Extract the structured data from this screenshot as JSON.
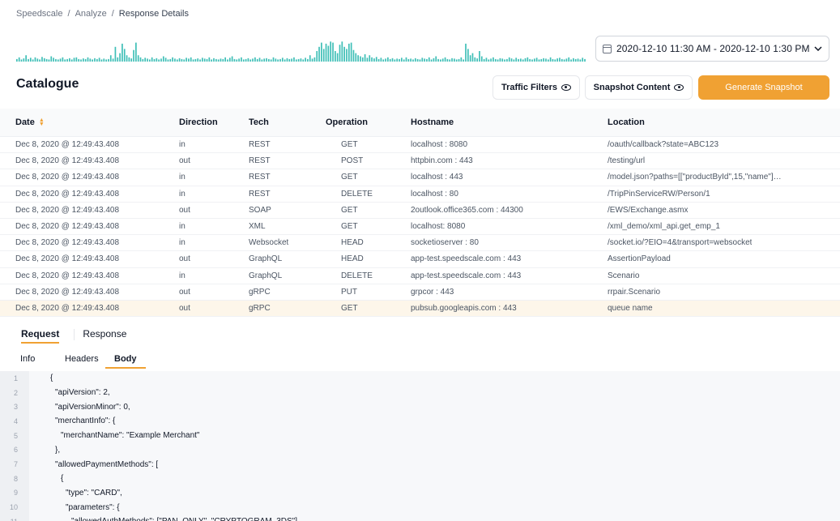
{
  "breadcrumb": [
    "Speedscale",
    "Analyze",
    "Response Details"
  ],
  "date_range": "2020-12-10 11:30 AM - 2020-12-10 1:30 PM",
  "catalogue": {
    "title": "Catalogue",
    "traffic_filters": "Traffic Filters",
    "snapshot_content": "Snapshot Content",
    "generate_snapshot": "Generate Snapshot"
  },
  "table": {
    "headers": [
      "Date",
      "Direction",
      "Tech",
      "Operation",
      "Hostname",
      "Location"
    ],
    "rows": [
      [
        "Dec 8, 2020 @ 12:49:43.408",
        "in",
        "REST",
        "GET",
        "localhost : 8080",
        "/oauth/callback?state=ABC123"
      ],
      [
        "Dec 8, 2020 @ 12:49:43.408",
        "out",
        "REST",
        "POST",
        "httpbin.com : 443",
        "/testing/url"
      ],
      [
        "Dec 8, 2020 @ 12:49:43.408",
        "in",
        "REST",
        "GET",
        "localhost : 443",
        "/model.json?paths=[[\"productById\",15,\"name\"]…"
      ],
      [
        "Dec 8, 2020 @ 12:49:43.408",
        "in",
        "REST",
        "DELETE",
        "localhost : 80",
        "/TripPinServiceRW/Person/1"
      ],
      [
        "Dec 8, 2020 @ 12:49:43.408",
        "out",
        "SOAP",
        "GET",
        "2outlook.office365.com : 44300",
        "/EWS/Exchange.asmx"
      ],
      [
        "Dec 8, 2020 @ 12:49:43.408",
        "in",
        "XML",
        "GET",
        "localhost: 8080",
        "/xml_demo/xml_api.get_emp_1"
      ],
      [
        "Dec 8, 2020 @ 12:49:43.408",
        "in",
        "Websocket",
        "HEAD",
        "socketioserver : 80",
        "/socket.io/?EIO=4&transport=websocket"
      ],
      [
        "Dec 8, 2020 @ 12:49:43.408",
        "out",
        "GraphQL",
        "HEAD",
        "app-test.speedscale.com : 443",
        "AssertionPayload"
      ],
      [
        "Dec 8, 2020 @ 12:49:43.408",
        "in",
        "GraphQL",
        "DELETE",
        "app-test.speedscale.com : 443",
        "Scenario"
      ],
      [
        "Dec 8, 2020 @ 12:49:43.408",
        "out",
        "gRPC",
        "PUT",
        "grpcor : 443",
        "rrpair.Scenario"
      ],
      [
        "Dec 8, 2020 @ 12:49:43.408",
        "out",
        "gRPC",
        "GET",
        "pubsub.googleapis.com : 443",
        "queue name"
      ]
    ],
    "selected_row": 10
  },
  "detail_tabs": [
    "Request",
    "Response"
  ],
  "sub_tabs": [
    "Info",
    "Headers",
    "Body"
  ],
  "code_lines": [
    {
      "n": "1",
      "indent": 62,
      "text": "{"
    },
    {
      "n": "2",
      "indent": 68,
      "text": "\"apiVersion\": 2,"
    },
    {
      "n": "3",
      "indent": 68,
      "text": "\"apiVersionMinor\": 0,"
    },
    {
      "n": "4",
      "indent": 68,
      "text": "\"merchantInfo\": {"
    },
    {
      "n": "5",
      "indent": 75,
      "text": "\"merchantName\": \"Example Merchant\""
    },
    {
      "n": "6",
      "indent": 68,
      "text": "},"
    },
    {
      "n": "7",
      "indent": 68,
      "text": "\"allowedPaymentMethods\": ["
    },
    {
      "n": "8",
      "indent": 75,
      "text": "{"
    },
    {
      "n": "9",
      "indent": 81,
      "text": "\"type\": \"CARD\","
    },
    {
      "n": "10",
      "indent": 81,
      "text": "\"parameters\": {"
    },
    {
      "n": "11",
      "indent": 88,
      "text": "\"allowedAuthMethods\": [\"PAN_ONLY\", \"CRYPTOGRAM_3DS\"],"
    }
  ],
  "colors": {
    "accent": "#f0a133",
    "spark": "#3fbfb7",
    "selected_row": "#fdf6ea"
  },
  "spark_levels": [
    0.12,
    0.2,
    0.1,
    0.15,
    0.3,
    0.12,
    0.18,
    0.1,
    0.2,
    0.14,
    0.1,
    0.22,
    0.16,
    0.12,
    0.1,
    0.25,
    0.18,
    0.12,
    0.1,
    0.14,
    0.2,
    0.1,
    0.12,
    0.16,
    0.1,
    0.18,
    0.2,
    0.12,
    0.1,
    0.15,
    0.12,
    0.2,
    0.14,
    0.1,
    0.16,
    0.12,
    0.18,
    0.1,
    0.14,
    0.1,
    0.12,
    0.3,
    0.14,
    0.7,
    0.2,
    0.4,
    0.85,
    0.6,
    0.3,
    0.2,
    0.15,
    0.55,
    0.9,
    0.3,
    0.2,
    0.12,
    0.18,
    0.14,
    0.1,
    0.2,
    0.12,
    0.16,
    0.1,
    0.14,
    0.25,
    0.18,
    0.1,
    0.12,
    0.2,
    0.14,
    0.1,
    0.16,
    0.12,
    0.1,
    0.18,
    0.14,
    0.2,
    0.1,
    0.12,
    0.15,
    0.1,
    0.18,
    0.14,
    0.12,
    0.2,
    0.1,
    0.16,
    0.12,
    0.1,
    0.14,
    0.12,
    0.2,
    0.1,
    0.18,
    0.25,
    0.12,
    0.1,
    0.14,
    0.2,
    0.1,
    0.12,
    0.16,
    0.1,
    0.14,
    0.2,
    0.12,
    0.18,
    0.1,
    0.14,
    0.16,
    0.12,
    0.1,
    0.2,
    0.14,
    0.1,
    0.12,
    0.18,
    0.1,
    0.16,
    0.12,
    0.14,
    0.2,
    0.1,
    0.12,
    0.15,
    0.1,
    0.18,
    0.12,
    0.3,
    0.14,
    0.2,
    0.5,
    0.7,
    0.9,
    0.6,
    0.85,
    0.75,
    0.95,
    0.9,
    0.5,
    0.4,
    0.8,
    0.95,
    0.7,
    0.6,
    0.85,
    0.9,
    0.55,
    0.4,
    0.3,
    0.25,
    0.2,
    0.35,
    0.18,
    0.3,
    0.2,
    0.15,
    0.22,
    0.12,
    0.18,
    0.1,
    0.14,
    0.2,
    0.12,
    0.16,
    0.1,
    0.14,
    0.12,
    0.18,
    0.1,
    0.2,
    0.12,
    0.14,
    0.1,
    0.16,
    0.12,
    0.1,
    0.18,
    0.14,
    0.12,
    0.2,
    0.1,
    0.16,
    0.25,
    0.12,
    0.1,
    0.14,
    0.2,
    0.12,
    0.1,
    0.16,
    0.14,
    0.1,
    0.12,
    0.2,
    0.1,
    0.85,
    0.6,
    0.3,
    0.4,
    0.2,
    0.15,
    0.5,
    0.25,
    0.12,
    0.18,
    0.1,
    0.14,
    0.2,
    0.12,
    0.1,
    0.16,
    0.14,
    0.1,
    0.12,
    0.2,
    0.15,
    0.1,
    0.18,
    0.12,
    0.14,
    0.1,
    0.16,
    0.2,
    0.12,
    0.1,
    0.14,
    0.18,
    0.1,
    0.12,
    0.16,
    0.14,
    0.1,
    0.2,
    0.12,
    0.1,
    0.15,
    0.18,
    0.12,
    0.1,
    0.14,
    0.2,
    0.1,
    0.16,
    0.12,
    0.14,
    0.1,
    0.18,
    0.12
  ]
}
